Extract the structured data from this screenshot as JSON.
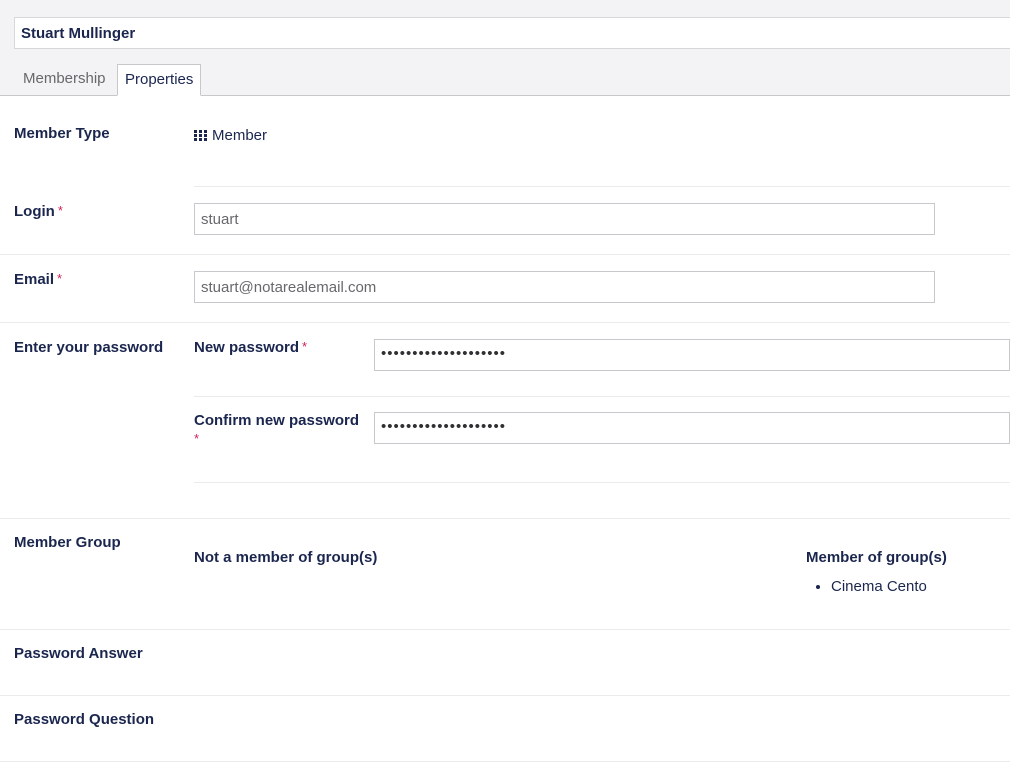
{
  "header": {
    "member_name": "Stuart Mullinger",
    "tabs": [
      {
        "label": "Membership"
      },
      {
        "label": "Properties"
      }
    ]
  },
  "properties": {
    "member_type": {
      "label": "Member Type",
      "value": "Member",
      "icon": "grid-icon"
    },
    "login": {
      "label": "Login",
      "required_mark": "*",
      "value": "stuart"
    },
    "email": {
      "label": "Email",
      "required_mark": "*",
      "value": "stuart@notarealemail.com"
    },
    "password": {
      "label": "Enter your password",
      "new_label": "New password",
      "new_required_mark": "*",
      "new_value": "••••••••••••••••••••",
      "confirm_label": "Confirm new password",
      "confirm_required_mark": "*",
      "confirm_value": "••••••••••••••••••••"
    },
    "member_group": {
      "label": "Member Group",
      "not_member_heading": "Not a member of group(s)",
      "member_heading": "Member of group(s)",
      "groups": [
        "Cinema Cento"
      ]
    },
    "password_answer": {
      "label": "Password Answer"
    },
    "password_question": {
      "label": "Password Question"
    }
  },
  "colors": {
    "text": "#1b264f",
    "required": "#d42054",
    "muted": "#68676b"
  }
}
